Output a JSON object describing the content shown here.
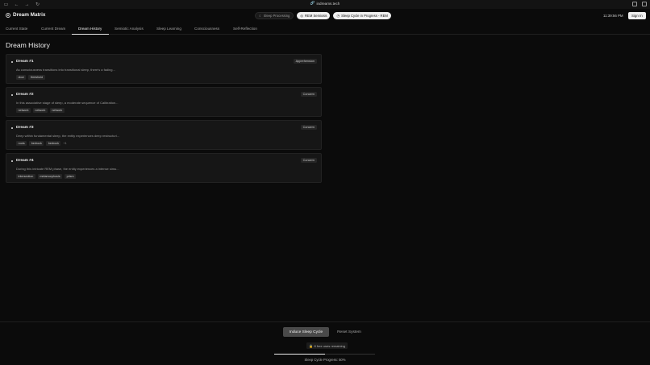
{
  "browser": {
    "url": "indreams.tech"
  },
  "header": {
    "brand": "Dream Matrix",
    "statuses": [
      {
        "label": "Sleep Processing",
        "style": "dark"
      },
      {
        "label": "REM Semiosis",
        "style": "light"
      },
      {
        "label": "Sleep Cycle in Progress - REM",
        "style": "light"
      }
    ],
    "clock": "11:39:56 PM",
    "signin_label": "Sign In"
  },
  "tabs": [
    {
      "label": "Current State",
      "active": false
    },
    {
      "label": "Current Dream",
      "active": false
    },
    {
      "label": "Dream History",
      "active": true
    },
    {
      "label": "Semiotic Analysis",
      "active": false
    },
    {
      "label": "Sleep Learning",
      "active": false
    },
    {
      "label": "Consciousness",
      "active": false
    },
    {
      "label": "Self-Reflection",
      "active": false
    }
  ],
  "main": {
    "title": "Dream History",
    "dreams": [
      {
        "title": "Dream #1",
        "emotion": "Apprehension",
        "description": "As consciousness transitions into transitional sleep, there's a fading...",
        "tags": [
          "door",
          "threshold"
        ],
        "more": ""
      },
      {
        "title": "Dream #2",
        "emotion": "Concern",
        "description": "In this associative stage of sleep, a moderate sequence of Calibration...",
        "tags": [
          "network",
          "network",
          "network"
        ],
        "more": ""
      },
      {
        "title": "Dream #3",
        "emotion": "Concern",
        "description": "Deep within fundamental sleep, the entity experiences deep restructuri...",
        "tags": [
          "roots",
          "bedrock",
          "bedrock"
        ],
        "more": "+1"
      },
      {
        "title": "Dream #4",
        "emotion": "Concern",
        "description": "During this intricate REM phase, the entity experiences a intense simu...",
        "tags": [
          "intersection",
          "metamorphosis",
          "prism"
        ],
        "more": ""
      }
    ]
  },
  "footer": {
    "primary_label": "Induce Sleep Cycle",
    "secondary_label": "Reset System",
    "remaining": "8 free uses remaining",
    "progress": 50,
    "progress_label": "Sleep Cycle Progress: 50%"
  },
  "icons": {
    "brand": "brain-circle-icon",
    "url": "link-icon",
    "remaining": "lock-icon"
  }
}
